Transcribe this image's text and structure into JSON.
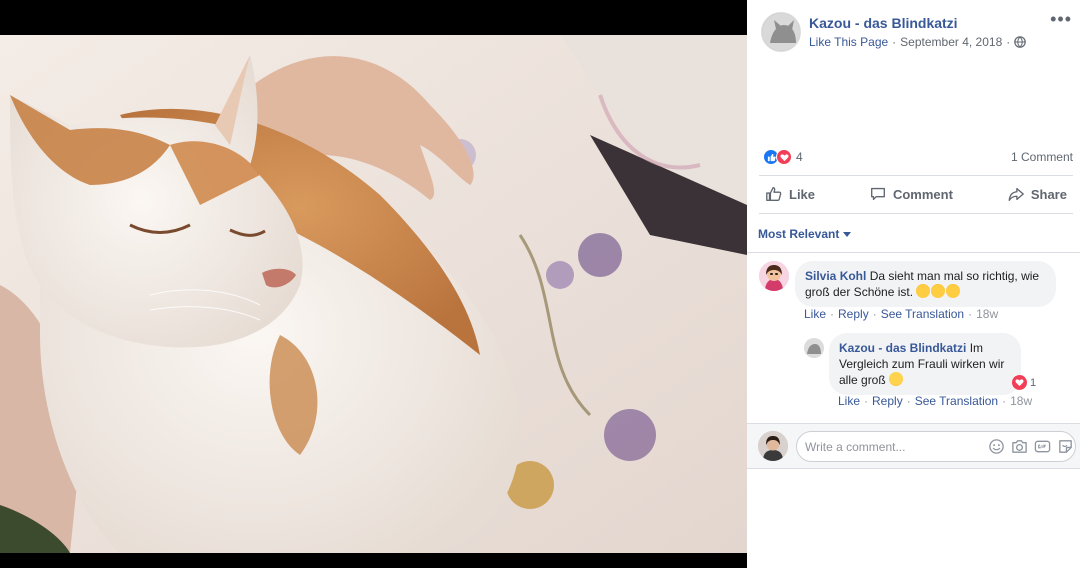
{
  "post": {
    "page_name": "Kazou - das Blindkatzi",
    "like_link": "Like This Page",
    "dot": "·",
    "date": "September 4, 2018",
    "more_label": "•••"
  },
  "reactions": {
    "count": "4",
    "comments_label": "1 Comment"
  },
  "actions": {
    "like": "Like",
    "comment": "Comment",
    "share": "Share"
  },
  "sort": {
    "label": "Most Relevant"
  },
  "comments": [
    {
      "author": "Silvia Kohl",
      "text": "Da sieht man mal so richtig, wie groß der Schöne ist.",
      "emoji": [
        "heart-eyes-cat-emoji",
        "heart-eyes-cat-emoji",
        "heart-eyes-cat-emoji"
      ],
      "actions": {
        "like": "Like",
        "reply": "Reply",
        "translate": "See Translation",
        "time": "18w",
        "sep": "·"
      }
    },
    {
      "author": "Kazou - das Blindkatzi",
      "text": "Im Vergleich zum Frauli wirken wir alle groß",
      "emoji": [
        "laughing-emoji"
      ],
      "love_count": "1",
      "actions": {
        "like": "Like",
        "reply": "Reply",
        "translate": "See Translation",
        "time": "18w",
        "sep": "·"
      }
    }
  ],
  "composer": {
    "placeholder": "Write a comment..."
  },
  "colors": {
    "link": "#385898",
    "like_blue": "#1877f2",
    "love_red": "#f33e58",
    "muted": "#606770"
  }
}
